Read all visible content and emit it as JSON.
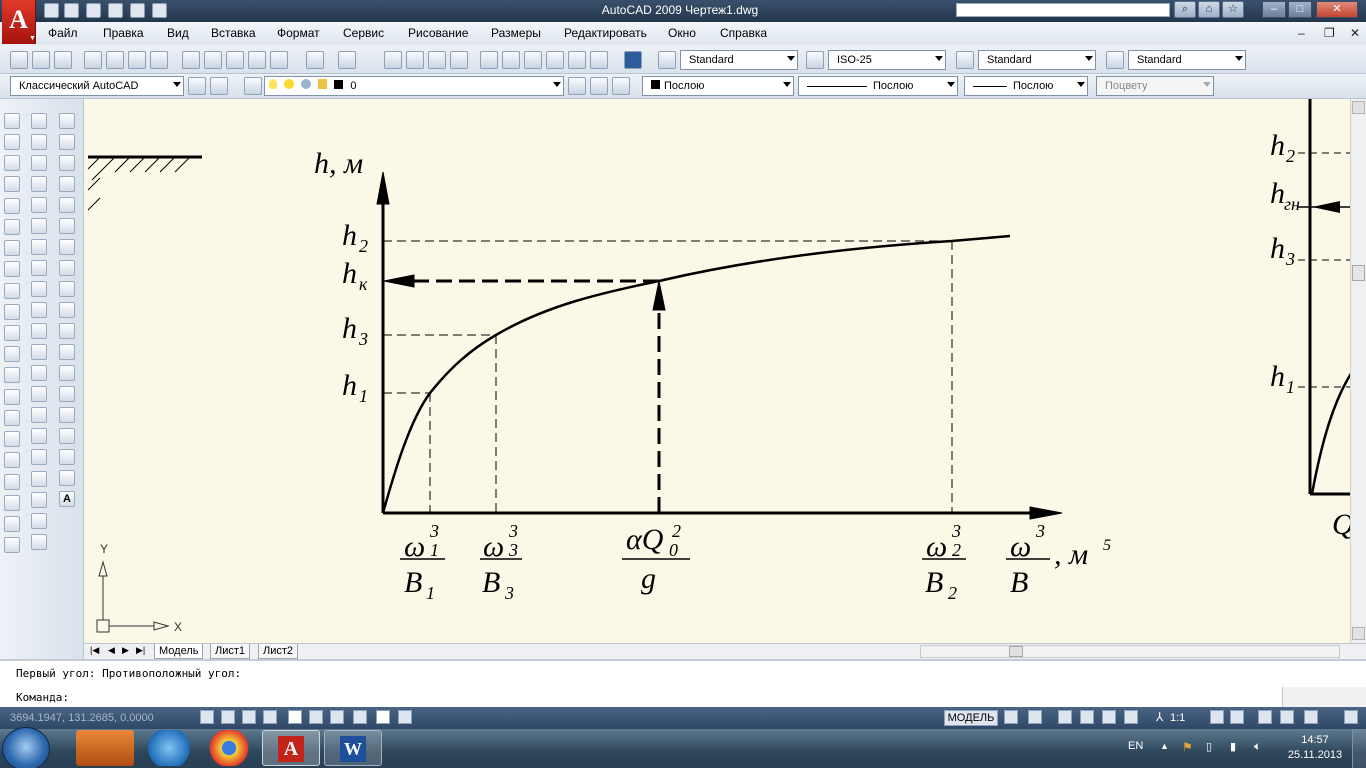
{
  "window": {
    "title": "AutoCAD 2009 Чертеж1.dwg"
  },
  "menu": [
    "Файл",
    "Правка",
    "Вид",
    "Вставка",
    "Формат",
    "Сервис",
    "Рисование",
    "Размеры",
    "Редактировать",
    "Окно",
    "Справка"
  ],
  "toolbars": {
    "text_style": "Standard",
    "dim_style": "ISO-25",
    "table_style": "Standard",
    "multileader_style": "Standard",
    "workspace": "Классический AutoCAD",
    "layer": "0",
    "color": "Послою",
    "linetype": "Послою",
    "lineweight": "Послою",
    "plotstyle": "Поцвету"
  },
  "drawing": {
    "y_axis_label": "h, м",
    "x_axis_tail": ", м",
    "x_axis_exp": "5",
    "ticks_y": [
      {
        "base": "h",
        "sub": "2"
      },
      {
        "base": "h",
        "sub": "к"
      },
      {
        "base": "h",
        "sub": "3"
      },
      {
        "base": "h",
        "sub": "1"
      }
    ],
    "fractions_x": [
      {
        "num": "ω",
        "num_sup": "3",
        "num_sub": "1",
        "den": "B",
        "den_sub": "1"
      },
      {
        "num": "ω",
        "num_sup": "3",
        "num_sub": "3",
        "den": "B",
        "den_sub": "3"
      },
      {
        "num": "αQ",
        "num_sup": "2",
        "num_sub": "0",
        "den": "g",
        "den_sub": ""
      },
      {
        "num": "ω",
        "num_sup": "3",
        "num_sub": "2",
        "den": "B",
        "den_sub": "2"
      },
      {
        "num": "ω",
        "num_sup": "3",
        "num_sub": "",
        "den": "B",
        "den_sub": ""
      }
    ],
    "right_labels": [
      {
        "base": "h",
        "sub": "2"
      },
      {
        "base": "h",
        "sub": "гн"
      },
      {
        "base": "h",
        "sub": "3"
      },
      {
        "base": "h",
        "sub": "1"
      },
      {
        "base": "Q",
        "sub": ""
      }
    ],
    "ucs_x": "X",
    "ucs_y": "Y"
  },
  "layout_tabs": [
    "Модель",
    "Лист1",
    "Лист2"
  ],
  "command": {
    "history": "Первый угол: Противоположный угол:",
    "prompt": "Команда:"
  },
  "status": {
    "coords": "3694.1947, 131.2685, 0.0000",
    "model": "МОДЕЛЬ",
    "scale": "1:1"
  },
  "taskbar": {
    "lang": "EN",
    "time": "14:57",
    "date": "25.11.2013"
  },
  "colors": {
    "drawing_bg": "#fbf8e8",
    "logo_red": "#d42c1f"
  }
}
